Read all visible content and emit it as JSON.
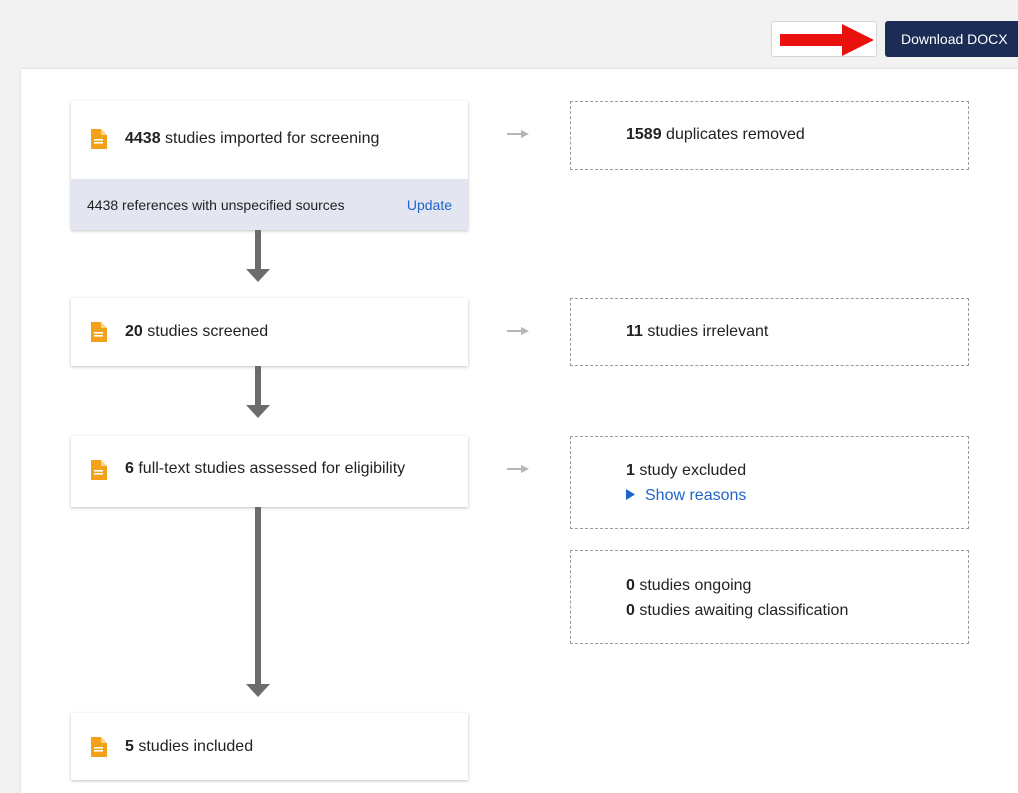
{
  "toolbar": {
    "download_label": "Download DOCX"
  },
  "flow": {
    "imported": {
      "count": "4438",
      "text": " studies imported for screening"
    },
    "unspecified": {
      "text": "4438 references with unspecified sources",
      "action": "Update"
    },
    "duplicates": {
      "count": "1589",
      "text": " duplicates removed"
    },
    "screened": {
      "count": "20",
      "text": " studies screened"
    },
    "irrelevant": {
      "count": "11",
      "text": " studies irrelevant"
    },
    "fulltext": {
      "count": "6",
      "text": " full-text studies assessed for eligibility"
    },
    "excluded": {
      "count": "1",
      "text": " study excluded",
      "link": "Show reasons"
    },
    "ongoing": {
      "count": "0",
      "text": " studies ongoing"
    },
    "awaiting": {
      "count": "0",
      "text": " studies awaiting classification"
    },
    "included": {
      "count": "5",
      "text": " studies included"
    }
  },
  "colors": {
    "accent_link": "#1f64c8",
    "download_bg": "#1b2d55",
    "icon_orange": "#f4a11a",
    "annotation_arrow": "#e8110e"
  },
  "icons": {
    "document": "document-icon",
    "right_arrow": "arrow-right-icon",
    "down_arrow": "arrow-down-icon",
    "caret": "caret-right-icon"
  }
}
